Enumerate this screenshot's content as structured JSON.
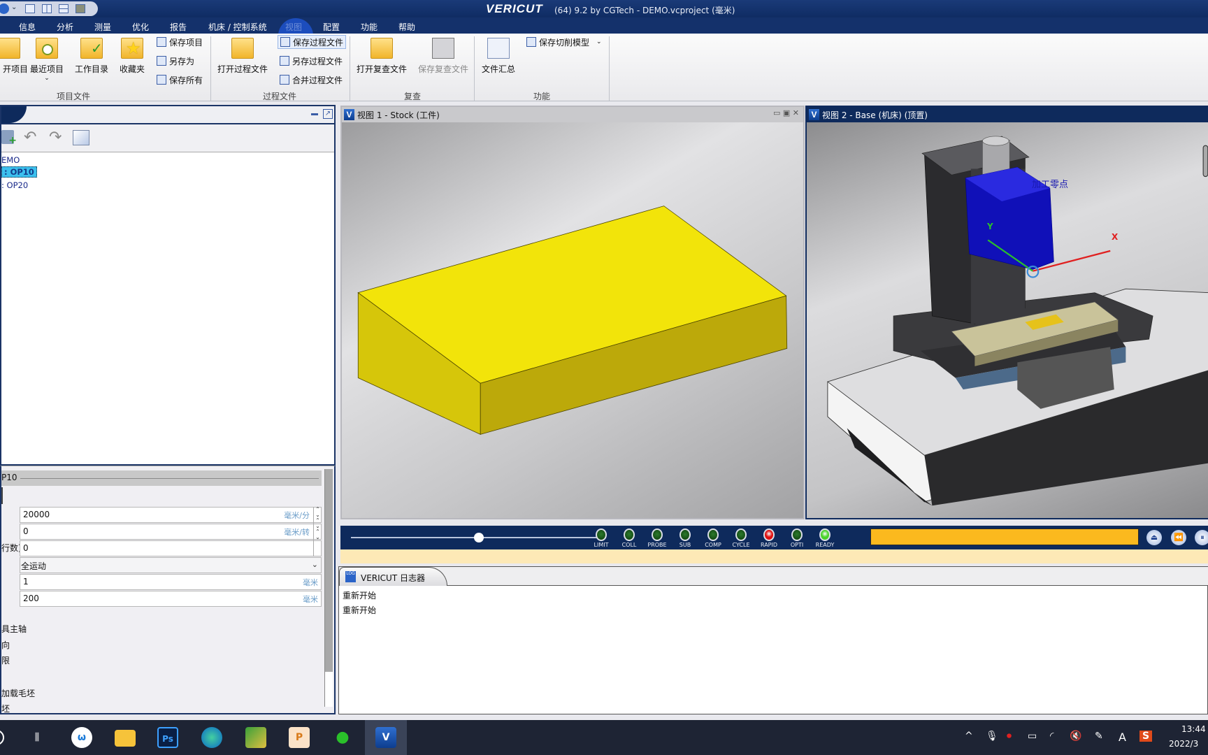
{
  "window": {
    "logo": "VERICUT",
    "title": "(64)  9.2 by CGTech - DEMO.vcproject (毫米)"
  },
  "menu": [
    "信息",
    "分析",
    "测量",
    "优化",
    "报告",
    "机床 / 控制系统",
    "视图",
    "配置",
    "功能",
    "帮助"
  ],
  "ribbon": {
    "project_group": {
      "label": "项目文件",
      "open": "开项目",
      "recent": "最近项目",
      "workdir": "工作目录",
      "favorites": "收藏夹",
      "save": "保存项目",
      "save_as": "另存为",
      "save_all": "保存所有"
    },
    "process_group": {
      "label": "过程文件",
      "open": "打开过程文件",
      "save": "保存过程文件",
      "save_as": "另存过程文件",
      "merge": "合并过程文件"
    },
    "review_group": {
      "label": "复查",
      "open": "打开复查文件",
      "save": "保存复查文件"
    },
    "function_group": {
      "label": "功能",
      "summary": "文件汇总",
      "save_cut_model": "保存切削模型"
    }
  },
  "project_tree": {
    "items": [
      "EMO",
      ": OP10",
      ": OP20"
    ],
    "selected": 1
  },
  "properties": {
    "header": "P10",
    "fields": [
      {
        "label": "",
        "value": "20000",
        "unit": "毫米/分"
      },
      {
        "label": "",
        "value": "0",
        "unit": "毫米/转"
      },
      {
        "label": "行数)",
        "value": "0",
        "unit": ""
      },
      {
        "label": "",
        "value": "全运动",
        "unit": ""
      },
      {
        "label": "",
        "value": "1",
        "unit": "毫米"
      },
      {
        "label": "",
        "value": "200",
        "unit": "毫米"
      }
    ],
    "labels": [
      "具主轴",
      "向",
      "限",
      "加载毛坯",
      "坯"
    ]
  },
  "views": [
    {
      "title": "视图 1 - Stock (工件)",
      "active": false
    },
    {
      "title": "视图 2 - Base (机床) (顶置)",
      "active": true,
      "annotation": "加工零点",
      "axis_x": "X",
      "axis_y": "Y"
    }
  ],
  "sim_control": {
    "slider_position": 0.5,
    "lights": [
      {
        "label": "LIMIT",
        "on": false
      },
      {
        "label": "COLL",
        "on": false
      },
      {
        "label": "PROBE",
        "on": false
      },
      {
        "label": "SUB",
        "on": false
      },
      {
        "label": "COMP",
        "on": false
      },
      {
        "label": "CYCLE",
        "on": false
      },
      {
        "label": "RAPID",
        "on": true,
        "color": "#e01010"
      },
      {
        "label": "OPTI",
        "on": false
      },
      {
        "label": "READY",
        "on": true,
        "color": "#4ad22a"
      }
    ],
    "progress_color": "#fbb91e"
  },
  "log": {
    "tab": "VERICUT 日志器",
    "lines": [
      "重新开始",
      "重新开始"
    ]
  },
  "taskbar": {
    "time": "13:44",
    "date": "2022/3",
    "tray_letter": "A"
  }
}
